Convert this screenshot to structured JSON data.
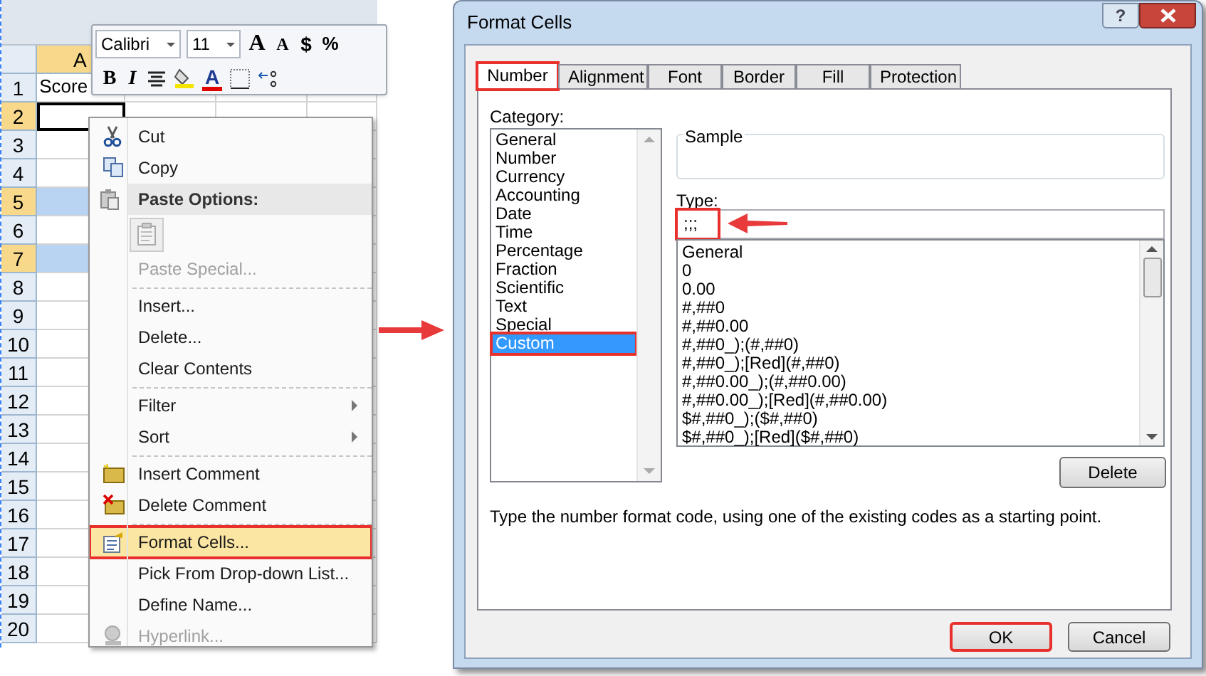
{
  "spreadsheet": {
    "column_header": "A",
    "rows": [
      {
        "number": "1",
        "value": "Score",
        "selected": false,
        "active": false
      },
      {
        "number": "2",
        "selected": true,
        "active": true
      },
      {
        "number": "3",
        "selected": false,
        "active": false
      },
      {
        "number": "4",
        "selected": false,
        "active": false
      },
      {
        "number": "5",
        "selected": true,
        "active": false
      },
      {
        "number": "6",
        "selected": false,
        "active": false
      },
      {
        "number": "7",
        "selected": true,
        "active": false
      },
      {
        "number": "8",
        "selected": false,
        "active": false
      },
      {
        "number": "9",
        "selected": false,
        "active": false
      },
      {
        "number": "10",
        "selected": false,
        "active": false
      },
      {
        "number": "11",
        "selected": false,
        "active": false
      },
      {
        "number": "12",
        "selected": false,
        "active": false
      },
      {
        "number": "13",
        "selected": false,
        "active": false
      },
      {
        "number": "14",
        "selected": false,
        "active": false
      },
      {
        "number": "15",
        "selected": false,
        "active": false
      },
      {
        "number": "16",
        "selected": false,
        "active": false
      },
      {
        "number": "17",
        "selected": false,
        "active": false
      },
      {
        "number": "18",
        "selected": false,
        "active": false
      },
      {
        "number": "19",
        "selected": false,
        "active": false
      },
      {
        "number": "20",
        "selected": false,
        "active": false
      }
    ]
  },
  "mini_toolbar": {
    "font": "Calibri",
    "size": "11",
    "grow_font": "A",
    "shrink_font": "A",
    "currency": "$",
    "percent": "%",
    "bold": "B",
    "italic": "I",
    "font_color": "A"
  },
  "context_menu": [
    {
      "kind": "item",
      "label": "Cut",
      "disabled": false,
      "submenu": false,
      "selected": false
    },
    {
      "kind": "item",
      "label": "Copy",
      "disabled": false,
      "submenu": false,
      "selected": false
    },
    {
      "kind": "header",
      "label": "Paste Options:"
    },
    {
      "kind": "paste_icons"
    },
    {
      "kind": "item",
      "label": "Paste Special...",
      "disabled": true,
      "submenu": false,
      "selected": false
    },
    {
      "kind": "separator"
    },
    {
      "kind": "item",
      "label": "Insert...",
      "disabled": false,
      "submenu": false,
      "selected": false
    },
    {
      "kind": "item",
      "label": "Delete...",
      "disabled": false,
      "submenu": false,
      "selected": false
    },
    {
      "kind": "item",
      "label": "Clear Contents",
      "disabled": false,
      "submenu": false,
      "selected": false
    },
    {
      "kind": "separator"
    },
    {
      "kind": "item",
      "label": "Filter",
      "disabled": false,
      "submenu": true,
      "selected": false
    },
    {
      "kind": "item",
      "label": "Sort",
      "disabled": false,
      "submenu": true,
      "selected": false
    },
    {
      "kind": "separator"
    },
    {
      "kind": "item",
      "label": "Insert Comment",
      "disabled": false,
      "submenu": false,
      "selected": false
    },
    {
      "kind": "item",
      "label": "Delete Comment",
      "disabled": false,
      "submenu": false,
      "selected": false
    },
    {
      "kind": "separator"
    },
    {
      "kind": "item",
      "label": "Format Cells...",
      "disabled": false,
      "submenu": false,
      "selected": true
    },
    {
      "kind": "item",
      "label": "Pick From Drop-down List...",
      "disabled": false,
      "submenu": false,
      "selected": false
    },
    {
      "kind": "item",
      "label": "Define Name...",
      "disabled": false,
      "submenu": false,
      "selected": false
    },
    {
      "kind": "item",
      "label": "Hyperlink...",
      "disabled": true,
      "submenu": false,
      "selected": false
    }
  ],
  "dialog": {
    "title": "Format Cells",
    "help_button": "?",
    "tabs": [
      {
        "label": "Number",
        "selected": true
      },
      {
        "label": "Alignment",
        "selected": false
      },
      {
        "label": "Font",
        "selected": false
      },
      {
        "label": "Border",
        "selected": false
      },
      {
        "label": "Fill",
        "selected": false
      },
      {
        "label": "Protection",
        "selected": false
      }
    ],
    "category": {
      "label": "Category:",
      "items": [
        {
          "label": "General",
          "selected": false
        },
        {
          "label": "Number",
          "selected": false
        },
        {
          "label": "Currency",
          "selected": false
        },
        {
          "label": "Accounting",
          "selected": false
        },
        {
          "label": "Date",
          "selected": false
        },
        {
          "label": "Time",
          "selected": false
        },
        {
          "label": "Percentage",
          "selected": false
        },
        {
          "label": "Fraction",
          "selected": false
        },
        {
          "label": "Scientific",
          "selected": false
        },
        {
          "label": "Text",
          "selected": false
        },
        {
          "label": "Special",
          "selected": false
        },
        {
          "label": "Custom",
          "selected": true
        }
      ]
    },
    "sample": {
      "label": "Sample"
    },
    "type": {
      "label": "Type:",
      "value": ";;;",
      "annotated": true
    },
    "formats": [
      "General",
      "0",
      "0.00",
      "#,##0",
      "#,##0.00",
      "#,##0_);(#,##0)",
      "#,##0_);[Red](#,##0)",
      "#,##0.00_);(#,##0.00)",
      "#,##0.00_);[Red](#,##0.00)",
      "$#,##0_);($#,##0)",
      "$#,##0_);[Red]($#,##0)"
    ],
    "delete_button": "Delete",
    "description": "Type the number format code, using one of the existing codes as a starting point.",
    "buttons": [
      {
        "label": "OK",
        "annotated": true
      },
      {
        "label": "Cancel",
        "annotated": false
      }
    ]
  }
}
